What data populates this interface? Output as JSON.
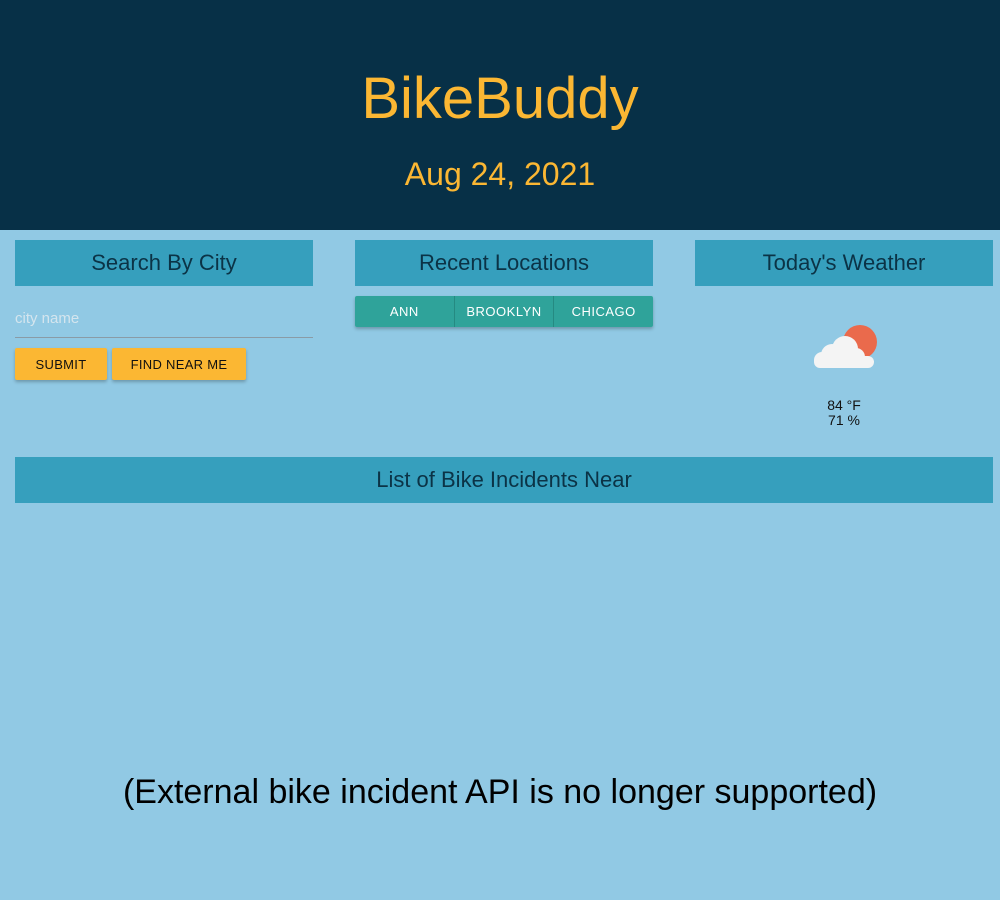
{
  "header": {
    "title": "BikeBuddy",
    "date": "Aug 24, 2021"
  },
  "search": {
    "heading": "Search By City",
    "placeholder": "city name",
    "submit_label": "SUBMIT",
    "near_label": "FIND NEAR ME"
  },
  "recent": {
    "heading": "Recent Locations",
    "locations": [
      "ANN",
      "BROOKLYN",
      "CHICAGO"
    ]
  },
  "weather": {
    "heading": "Today's Weather",
    "icon": "partly-cloudy-icon",
    "temperature": "84 °F",
    "humidity": "71 %"
  },
  "incidents": {
    "heading": "List of Bike Incidents Near",
    "notice": "(External bike incident API is no longer supported)"
  },
  "colors": {
    "header_bg": "#073047",
    "accent_yellow": "#fbb733",
    "page_bg": "#91c9e4",
    "panel_heading_bg": "#369fbd",
    "recent_button_bg": "#2fa39a"
  }
}
